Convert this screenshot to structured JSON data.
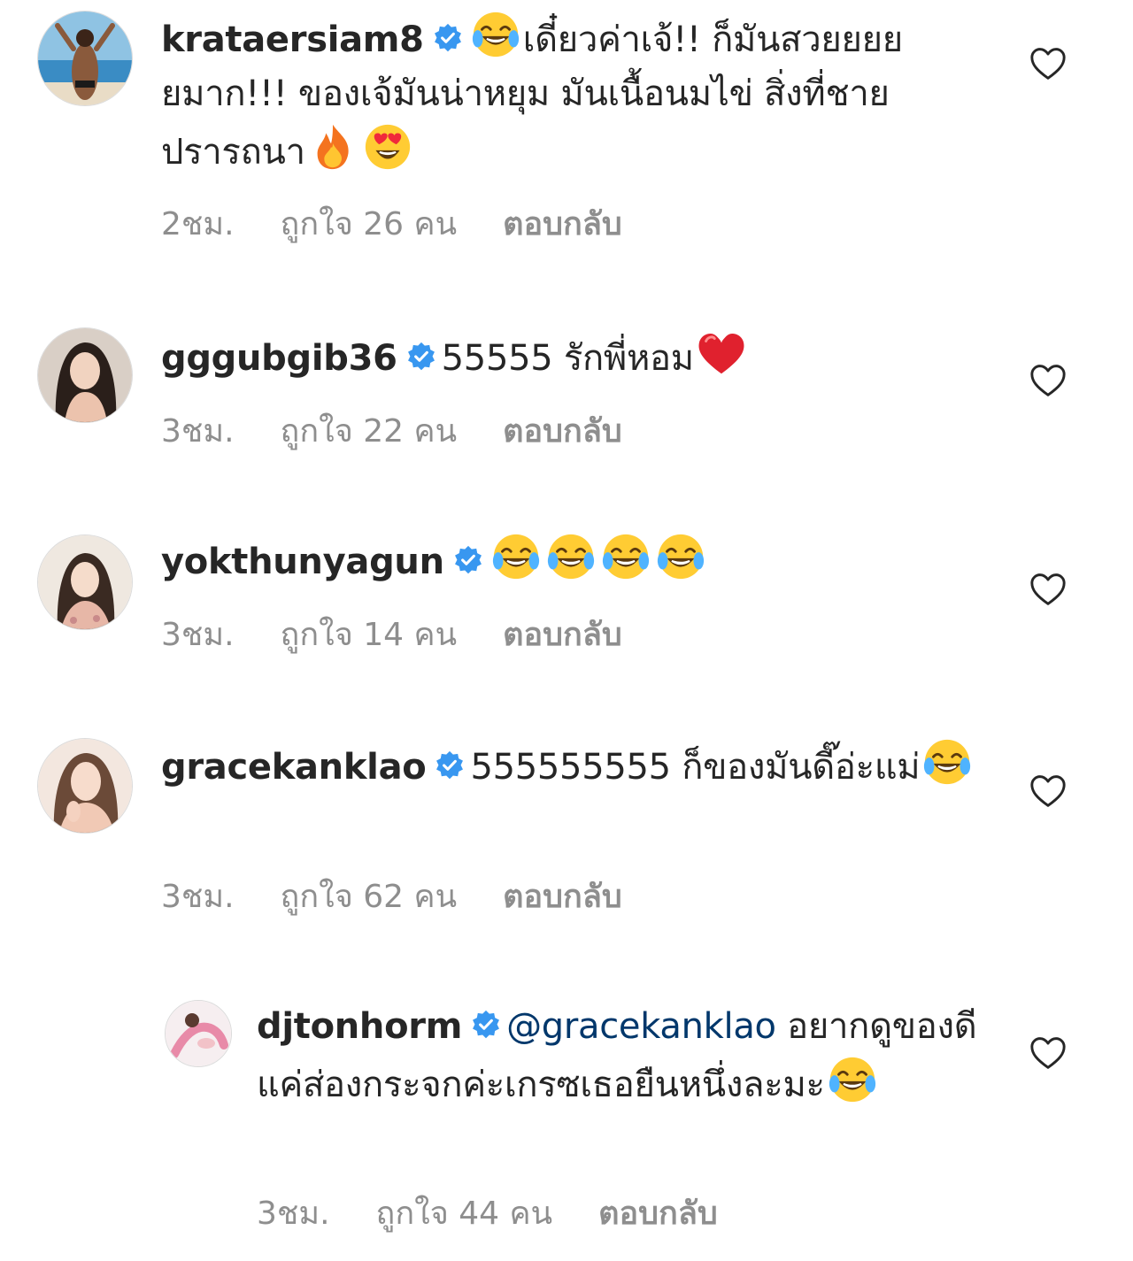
{
  "comments": [
    {
      "username": "krataersiam8",
      "text": "เดี๋ยวค่าเจ้!! ก็มันสวยยยยยมาก!!! ของเจ้มันน่าหยุม  มันเนื้อนมไข่ สิ่งที่ชายปรารถนา",
      "time": "2ชม.",
      "likes": "ถูกใจ 26 คน",
      "reply": "ตอบกลับ"
    },
    {
      "username": "gggubgib36",
      "text": "55555 รักพี่หอม",
      "time": "3ชม.",
      "likes": "ถูกใจ 22 คน",
      "reply": "ตอบกลับ"
    },
    {
      "username": "yokthunyagun",
      "text": "",
      "time": "3ชม.",
      "likes": "ถูกใจ 14 คน",
      "reply": "ตอบกลับ"
    },
    {
      "username": "gracekanklao",
      "text": "555555555 ก็ของมันดี๊อ่ะแม่",
      "time": "3ชม.",
      "likes": "ถูกใจ 62 คน",
      "reply": "ตอบกลับ"
    }
  ],
  "reply_comment": {
    "username": "djtonhorm",
    "mention": "@gracekanklao",
    "text": " อยากดูของดีแค่ส่องกระจกค่ะเกรซเธอยืนหนึ่งละมะ",
    "time": "3ชม.",
    "likes": "ถูกใจ 44 คน",
    "reply": "ตอบกลับ"
  },
  "colors": {
    "text": "#262626",
    "meta": "#8e8e8e",
    "verified": "#3897f0",
    "mention": "#00376b"
  },
  "icons": [
    "verified-badge-icon",
    "heart-outline-icon",
    "tears-of-joy-emoji",
    "fire-emoji",
    "heart-eyes-emoji",
    "red-heart-emoji"
  ]
}
